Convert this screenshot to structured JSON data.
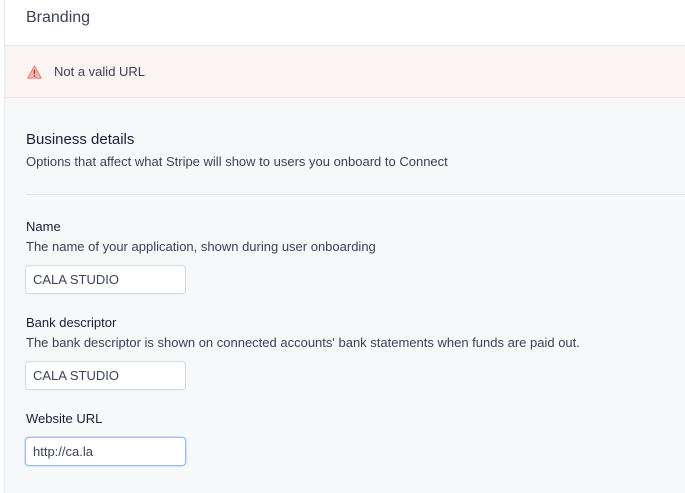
{
  "header": {
    "title": "Branding"
  },
  "alert": {
    "icon": "warning-icon",
    "message": "Not a valid URL",
    "color": "#e56f6f"
  },
  "business_details": {
    "title": "Business details",
    "description": "Options that affect what Stripe will show to users you onboard to Connect"
  },
  "fields": {
    "name": {
      "label": "Name",
      "hint": "The name of your application, shown during user onboarding",
      "value": "CALA STUDIO"
    },
    "bank_descriptor": {
      "label": "Bank descriptor",
      "hint": "The bank descriptor is shown on connected accounts' bank statements when funds are paid out.",
      "value": "CALA STUDIO"
    },
    "website_url": {
      "label": "Website URL",
      "value": "http://ca.la"
    }
  }
}
